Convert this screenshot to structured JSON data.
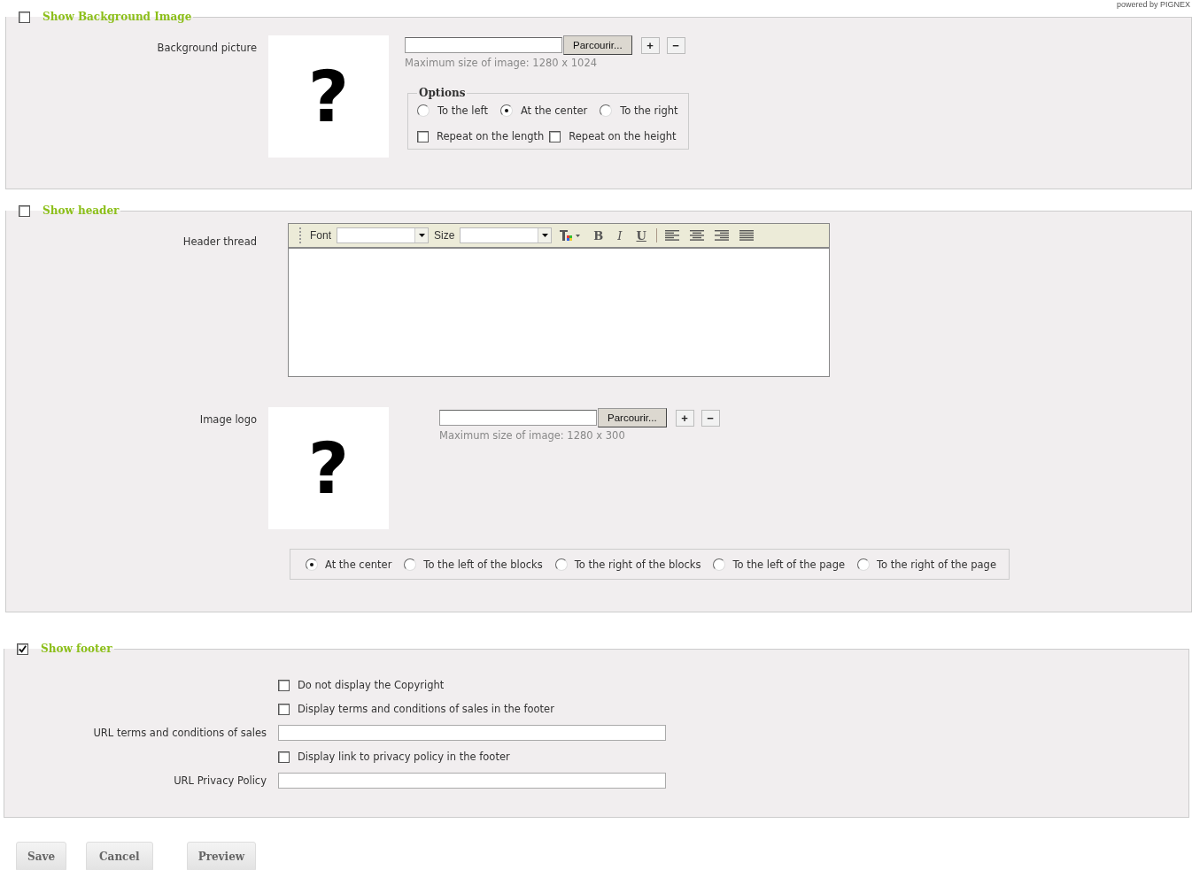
{
  "powered_by": "powered by PIGNEX",
  "background": {
    "title": "Show Background Image",
    "checked": false,
    "label": "Background picture",
    "placeholder_glyph": "?",
    "browse_button": "Parcourir...",
    "add_button": "+",
    "remove_button": "−",
    "hint": "Maximum size of image: 1280 x 1024",
    "options_legend": "Options",
    "positions": [
      {
        "label": "To the left",
        "selected": false
      },
      {
        "label": "At the center",
        "selected": true
      },
      {
        "label": "To the right",
        "selected": false
      }
    ],
    "repeats": [
      {
        "label": "Repeat on the length",
        "checked": false
      },
      {
        "label": "Repeat on the height",
        "checked": false
      }
    ]
  },
  "header": {
    "title": "Show header",
    "checked": false,
    "thread_label": "Header thread",
    "toolbar": [
      {
        "kind": "label",
        "text": "Font"
      },
      {
        "kind": "select"
      },
      {
        "kind": "label",
        "text": "Size"
      },
      {
        "kind": "select"
      },
      {
        "kind": "color"
      },
      {
        "kind": "bold",
        "text": "B"
      },
      {
        "kind": "italic",
        "text": "I"
      },
      {
        "kind": "underline",
        "text": "U"
      },
      {
        "kind": "separator"
      },
      {
        "kind": "align-left"
      },
      {
        "kind": "align-center"
      },
      {
        "kind": "align-right"
      },
      {
        "kind": "justify"
      }
    ],
    "logo_label": "Image logo",
    "placeholder_glyph": "?",
    "browse_button": "Parcourir...",
    "add_button": "+",
    "remove_button": "−",
    "hint": "Maximum size of image: 1280 x 300",
    "positions": [
      {
        "label": "At the center",
        "selected": true
      },
      {
        "label": "To the left of the blocks",
        "selected": false
      },
      {
        "label": "To the right of the blocks",
        "selected": false
      },
      {
        "label": "To the left of the page",
        "selected": false
      },
      {
        "label": "To the right of the page",
        "selected": false
      }
    ]
  },
  "footer": {
    "title": "Show footer",
    "checked": true,
    "rows": [
      {
        "kind": "checkbox",
        "label": "Do not display the Copyright",
        "checked": false
      },
      {
        "kind": "checkbox",
        "label": "Display terms and conditions of sales in the footer",
        "checked": false
      },
      {
        "kind": "url",
        "label": "URL terms and conditions of sales"
      },
      {
        "kind": "checkbox",
        "label": "Display link to privacy policy in the footer",
        "checked": false
      },
      {
        "kind": "url",
        "label": "URL Privacy Policy"
      }
    ]
  },
  "buttons": [
    {
      "kind": "save",
      "label": "Save"
    },
    {
      "kind": "cancel",
      "label": "Cancel"
    },
    {
      "kind": "preview",
      "label": "Preview"
    }
  ]
}
